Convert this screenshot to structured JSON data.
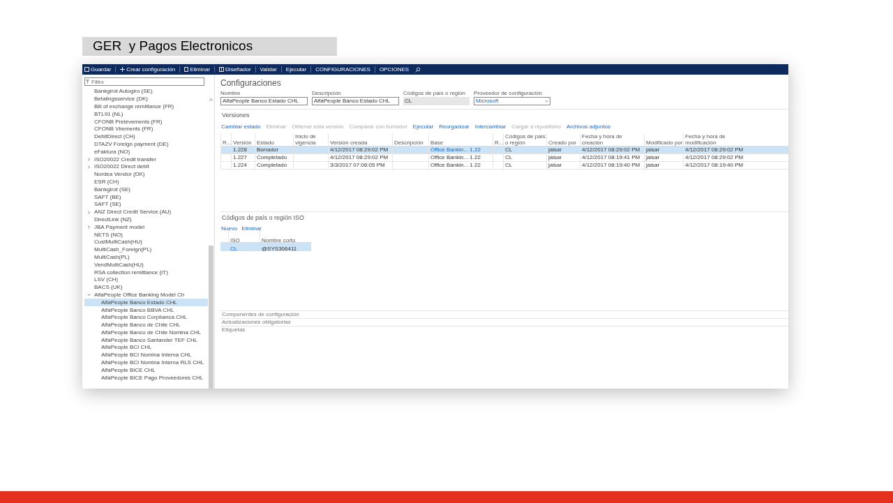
{
  "slide_title": "GER  y Pagos Electronicos",
  "toolbar": [
    {
      "label": "Guardar",
      "kind": "save"
    },
    {
      "label": "Crear configuración",
      "kind": "add"
    },
    {
      "label": "Eliminar",
      "kind": "delete"
    },
    {
      "label": "Diseñador",
      "kind": "design"
    },
    {
      "label": "Validar",
      "kind": "plain"
    },
    {
      "label": "Ejecutar",
      "kind": "plain"
    },
    {
      "label": "CONFIGURACIONES",
      "kind": "plain"
    },
    {
      "label": "OPCIONES",
      "kind": "plain"
    }
  ],
  "filter": {
    "placeholder": "Filtro"
  },
  "tree": [
    {
      "label": "Bankgirot Autogiro (SE)"
    },
    {
      "label": "Betalingsservice (DK)"
    },
    {
      "label": "Bill of exchange remittance (FR)"
    },
    {
      "label": "BTL91 (NL)"
    },
    {
      "label": "CFONB Prelèvements (FR)"
    },
    {
      "label": "CFONB Virements (FR)"
    },
    {
      "label": "DebitDirect (CH)"
    },
    {
      "label": "DTAZV Foreign payment (DE)"
    },
    {
      "label": "eFaktura (NO)"
    },
    {
      "label": "ISO20022 Credit transfer",
      "expanded": false
    },
    {
      "label": "ISO20022 Direct debit",
      "expanded": false
    },
    {
      "label": "Nordea Vendor (DK)"
    },
    {
      "label": "ESR (CH)"
    },
    {
      "label": "Bankgirot (SE)"
    },
    {
      "label": "SAFT (BE)"
    },
    {
      "label": "SAFT (SE)"
    },
    {
      "label": "ANZ Direct Credit Service (AU)",
      "expanded": false
    },
    {
      "label": "DirectLink (NZ)"
    },
    {
      "label": "JBA Payment model",
      "expanded": false
    },
    {
      "label": "NETS (NO)"
    },
    {
      "label": "CustMultiCash(HU)"
    },
    {
      "label": "MultiCash_Foreign(PL)"
    },
    {
      "label": "MultiCash(PL)"
    },
    {
      "label": "VendMultiCash(HU)"
    },
    {
      "label": "RSA collection remittance (IT)"
    },
    {
      "label": "LSV (CH)"
    },
    {
      "label": "BACS (UK)"
    },
    {
      "label": "AlfaPeople Office Banking Model Ch",
      "expanded": true,
      "children": [
        {
          "label": "AlfaPeople Banco Estado CHL",
          "selected": true
        },
        {
          "label": "AlfaPeople Banco BBVA CHL",
          "selected": false
        },
        {
          "label": "AlfaPeople Banco Corpbanca CHL",
          "selected": false
        },
        {
          "label": "AlfaPeople Banco de Chile CHL",
          "selected": false
        },
        {
          "label": "AlfaPeople Banco de Chile Nomina CHL",
          "selected": false
        },
        {
          "label": "AlfaPeople Banco Santander TEF CHL",
          "selected": false
        },
        {
          "label": "AlfaPeople BCI CHL",
          "selected": false
        },
        {
          "label": "AlfaPeople BCI Nomina Interna CHL",
          "selected": false
        },
        {
          "label": "AlfaPeople BCI Nomina Interna RLS CHL",
          "selected": false
        },
        {
          "label": "AlfaPeople BICE CHL",
          "selected": false
        },
        {
          "label": "AlfaPeople BICE Pago Proveedores CHL",
          "selected": false
        }
      ]
    }
  ],
  "page_title": "Configuraciones",
  "fields": [
    {
      "label": "Nombre",
      "value": "AlfaPeople Banco Estado CHL",
      "kind": "text"
    },
    {
      "label": "Descripción",
      "value": "AlfaPeople Banco Estado CHL",
      "kind": "text"
    },
    {
      "label": "Códigos de país o región",
      "value": "CL",
      "kind": "readonly"
    },
    {
      "label": "Proveedor de configuración",
      "value": "Microsoft",
      "kind": "select"
    }
  ],
  "versions": {
    "title": "Versiones",
    "actions": [
      {
        "label": "Cambiar estado",
        "disabled": false
      },
      {
        "label": "Eliminar",
        "disabled": true
      },
      {
        "label": "Obtener esta versión",
        "disabled": true
      },
      {
        "label": "Comparar con borrador",
        "disabled": true
      },
      {
        "label": "Ejecutar",
        "disabled": false
      },
      {
        "label": "Reorganizar",
        "disabled": false
      },
      {
        "label": "Intercambiar",
        "disabled": false
      },
      {
        "label": "Cargar a repositorio",
        "disabled": true
      },
      {
        "label": "Archivos adjuntos",
        "disabled": false
      }
    ],
    "columns": [
      "R...",
      "Versión",
      "Estado",
      "Inicio de vigencia",
      "Versión creada",
      "Descripción",
      "Base",
      "R...",
      "Códigos de país o región",
      "Creado por",
      "Fecha y hora de creación",
      "Modificado por",
      "Fecha y hora de modificación"
    ],
    "rows": [
      {
        "selected": true,
        "cells": [
          "",
          "1.228",
          "Borrador",
          "",
          "4/12/2017 08:29:02 PM",
          "",
          "Office Bankin...  1.22",
          "",
          "CL",
          "jaisar",
          "4/12/2017 08:29:02 PM",
          "jaisar",
          "4/12/2017 08:29:02 PM"
        ]
      },
      {
        "selected": false,
        "cells": [
          "",
          "1.227",
          "Completado",
          "",
          "4/12/2017 08:29:02 PM",
          "",
          "Office Bankin...  1.22",
          "",
          "CL",
          "jaisar",
          "4/12/2017 08:19:41 PM",
          "jaisar",
          "4/12/2017 08:29:02 PM"
        ]
      },
      {
        "selected": false,
        "cells": [
          "",
          "1.224",
          "Completado",
          "",
          "3/3/2017 07:06:05 PM",
          "",
          "Office Bankin...  1.22",
          "",
          "CL",
          "jaisar",
          "4/12/2017 08:19:40 PM",
          "jaisar",
          "4/12/2017 08:19:40 PM"
        ]
      }
    ]
  },
  "iso": {
    "title": "Códigos de país o región ISO",
    "actions": [
      "Nuevo",
      "Eliminar"
    ],
    "columns": [
      "ISO",
      "Nombre corto"
    ],
    "rows": [
      {
        "selected": true,
        "cells": [
          "CL",
          "@SYS306411"
        ]
      }
    ]
  },
  "sections": [
    "Componentes de configuración",
    "Actualizaciones obligatorias",
    "Etiquetas"
  ]
}
